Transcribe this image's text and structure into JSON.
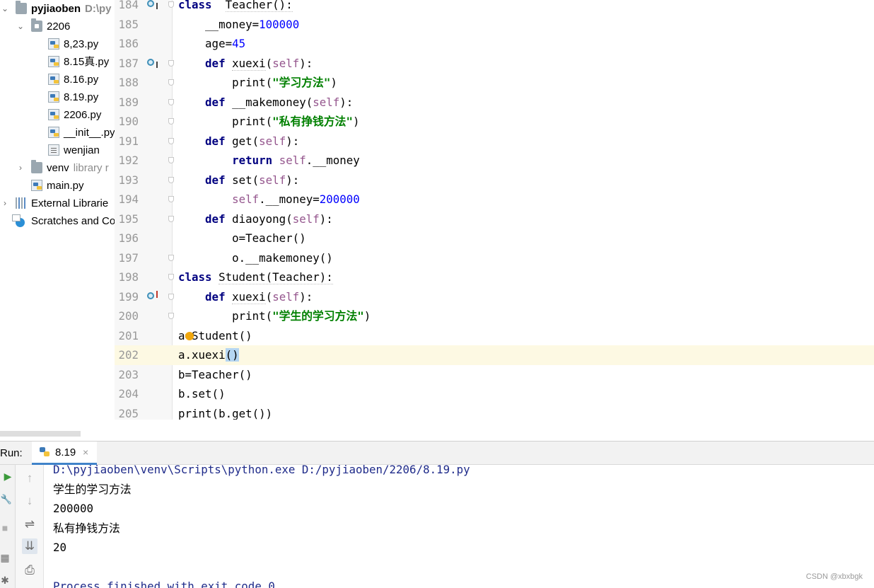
{
  "project_tree": [
    {
      "label": "pyjiaoben",
      "hint": "D:\\py",
      "type": "folder",
      "indent": 0,
      "arrow": "⌄",
      "bold": true
    },
    {
      "label": "2206",
      "type": "package",
      "indent": 1,
      "arrow": "⌄"
    },
    {
      "label": "8,23.py",
      "type": "py",
      "indent": 2
    },
    {
      "label": "8.15真.py",
      "type": "py",
      "indent": 2
    },
    {
      "label": "8.16.py",
      "type": "py",
      "indent": 2
    },
    {
      "label": "8.19.py",
      "type": "py",
      "indent": 2
    },
    {
      "label": "2206.py",
      "type": "py",
      "indent": 2
    },
    {
      "label": "__init__.py",
      "type": "py",
      "indent": 2
    },
    {
      "label": "wenjian",
      "type": "txt",
      "indent": 2
    },
    {
      "label": "venv",
      "hint": "library r",
      "type": "folder",
      "indent": 1,
      "arrow": "›"
    },
    {
      "label": "main.py",
      "type": "py",
      "indent": 1
    },
    {
      "label": "External Librarie",
      "type": "libs",
      "indent": 0,
      "arrow": "›"
    },
    {
      "label": "Scratches and Co",
      "type": "scratch",
      "indent": 0
    }
  ],
  "editor": {
    "lines": [
      {
        "n": "184",
        "mark": "impl",
        "fold": true,
        "tokens": [
          [
            "kw",
            "class"
          ],
          [
            "",
            "  "
          ],
          [
            "ul",
            "Teacher():"
          ]
        ]
      },
      {
        "n": "185",
        "tokens": [
          [
            "",
            "    __money="
          ],
          [
            "num",
            "100000"
          ]
        ]
      },
      {
        "n": "186",
        "tokens": [
          [
            "",
            "    age="
          ],
          [
            "num",
            "45"
          ]
        ]
      },
      {
        "n": "187",
        "mark": "impl",
        "fold": true,
        "tokens": [
          [
            "",
            "    "
          ],
          [
            "kw",
            "def"
          ],
          [
            "",
            " "
          ],
          [
            "ul",
            "xuexi"
          ],
          [
            "",
            "("
          ],
          [
            "selfc",
            "self"
          ],
          [
            "",
            "):"
          ]
        ]
      },
      {
        "n": "188",
        "fold": true,
        "tokens": [
          [
            "",
            "        print("
          ],
          [
            "str",
            "\"学习方法\""
          ],
          [
            "",
            ")"
          ]
        ]
      },
      {
        "n": "189",
        "fold": true,
        "tokens": [
          [
            "",
            "    "
          ],
          [
            "kw",
            "def"
          ],
          [
            "",
            " __makemoney("
          ],
          [
            "selfc",
            "self"
          ],
          [
            "",
            "):"
          ]
        ]
      },
      {
        "n": "190",
        "fold": true,
        "tokens": [
          [
            "",
            "        print("
          ],
          [
            "str",
            "\"私有挣钱方法\""
          ],
          [
            "",
            ")"
          ]
        ]
      },
      {
        "n": "191",
        "fold": true,
        "tokens": [
          [
            "",
            "    "
          ],
          [
            "kw",
            "def"
          ],
          [
            "",
            " get("
          ],
          [
            "selfc",
            "self"
          ],
          [
            "",
            "):"
          ]
        ]
      },
      {
        "n": "192",
        "fold": true,
        "tokens": [
          [
            "",
            "        "
          ],
          [
            "kw",
            "return"
          ],
          [
            "",
            " "
          ],
          [
            "selfc",
            "self"
          ],
          [
            "",
            ".__money"
          ]
        ]
      },
      {
        "n": "193",
        "fold": true,
        "tokens": [
          [
            "",
            "    "
          ],
          [
            "kw",
            "def"
          ],
          [
            "",
            " set("
          ],
          [
            "selfc",
            "self"
          ],
          [
            "",
            "):"
          ]
        ]
      },
      {
        "n": "194",
        "fold": true,
        "tokens": [
          [
            "",
            "        "
          ],
          [
            "selfc",
            "self"
          ],
          [
            "",
            ".__money="
          ],
          [
            "num",
            "200000"
          ]
        ]
      },
      {
        "n": "195",
        "fold": true,
        "tokens": [
          [
            "",
            "    "
          ],
          [
            "kw",
            "def"
          ],
          [
            "",
            " diaoyong("
          ],
          [
            "selfc",
            "self"
          ],
          [
            "",
            "):"
          ]
        ]
      },
      {
        "n": "196",
        "tokens": [
          [
            "",
            "        o=Teacher()"
          ]
        ]
      },
      {
        "n": "197",
        "fold": true,
        "tokens": [
          [
            "",
            "        o.__makemoney()"
          ]
        ]
      },
      {
        "n": "198",
        "fold": true,
        "tokens": [
          [
            "kw",
            "class"
          ],
          [
            "",
            " "
          ],
          [
            "ul",
            "Student(Teacher):"
          ]
        ]
      },
      {
        "n": "199",
        "mark": "over",
        "fold": true,
        "tokens": [
          [
            "",
            "    "
          ],
          [
            "kw",
            "def"
          ],
          [
            "",
            " "
          ],
          [
            "ul",
            "xuexi"
          ],
          [
            "",
            "("
          ],
          [
            "selfc",
            "self"
          ],
          [
            "",
            "):"
          ]
        ]
      },
      {
        "n": "200",
        "fold": true,
        "tokens": [
          [
            "",
            "        print("
          ],
          [
            "str",
            "\"学生的学习方法\""
          ],
          [
            "",
            ")"
          ]
        ]
      },
      {
        "n": "201",
        "bulb": true,
        "tokens": [
          [
            "",
            "a=Student()"
          ]
        ]
      },
      {
        "n": "202",
        "current": true,
        "tokens": [
          [
            "",
            "a.xuexi"
          ],
          [
            "bracket",
            "()"
          ]
        ]
      },
      {
        "n": "203",
        "tokens": [
          [
            "",
            "b=Teacher()"
          ]
        ]
      },
      {
        "n": "204",
        "tokens": [
          [
            "",
            "b.set()"
          ]
        ]
      },
      {
        "n": "205",
        "tokens": [
          [
            "",
            "print(b.get())"
          ]
        ]
      }
    ]
  },
  "run_panel": {
    "label": "Run:",
    "tab_label": "8.19",
    "tab_close": "×",
    "tools": [
      "↑",
      "↓",
      "⇌",
      "⇊",
      "⎙"
    ],
    "left_tools": [
      "▶",
      "🔧",
      "■",
      "▦",
      "✱"
    ],
    "console_lines": [
      {
        "text": "D:\\pyjiaoben\\venv\\Scripts\\python.exe D:/pyjiaoben/2206/8.19.py",
        "type": "cmd"
      },
      {
        "text": "学生的学习方法",
        "type": "out"
      },
      {
        "text": "200000",
        "type": "out"
      },
      {
        "text": "私有挣钱方法",
        "type": "out"
      },
      {
        "text": "20",
        "type": "out"
      },
      {
        "text": "",
        "type": "out"
      },
      {
        "text": "Process finished with exit code 0",
        "type": "cmd"
      }
    ]
  },
  "watermark": "CSDN @xbxbgk",
  "colors": {
    "keyword": "#000080",
    "number": "#0000ff",
    "string": "#008000",
    "self": "#94558d",
    "current_line": "#fdf9e3",
    "tab_underline": "#4083c9"
  }
}
